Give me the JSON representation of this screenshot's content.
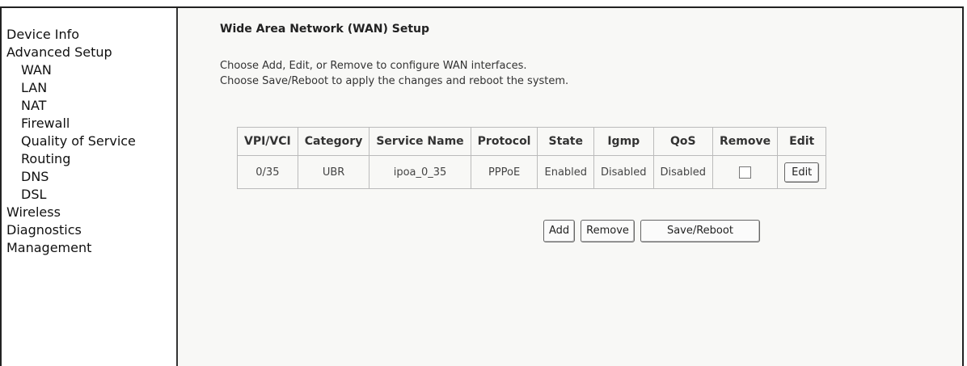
{
  "sidebar": {
    "items": [
      {
        "label": "Device Info",
        "sub": false
      },
      {
        "label": "Advanced Setup",
        "sub": false
      },
      {
        "label": "WAN",
        "sub": true
      },
      {
        "label": "LAN",
        "sub": true
      },
      {
        "label": "NAT",
        "sub": true
      },
      {
        "label": "Firewall",
        "sub": true
      },
      {
        "label": "Quality of Service",
        "sub": true
      },
      {
        "label": "Routing",
        "sub": true
      },
      {
        "label": "DNS",
        "sub": true
      },
      {
        "label": "DSL",
        "sub": true
      },
      {
        "label": "Wireless",
        "sub": false
      },
      {
        "label": "Diagnostics",
        "sub": false
      },
      {
        "label": "Management",
        "sub": false
      }
    ]
  },
  "main": {
    "title": "Wide Area Network (WAN) Setup",
    "desc_line1": "Choose Add, Edit, or Remove to configure WAN interfaces.",
    "desc_line2": "Choose Save/Reboot to apply the changes and reboot the system."
  },
  "table": {
    "headers": [
      "VPI/VCI",
      "Category",
      "Service Name",
      "Protocol",
      "State",
      "Igmp",
      "QoS",
      "Remove",
      "Edit"
    ],
    "rows": [
      {
        "vpi_vci": "0/35",
        "category": "UBR",
        "service_name": "ipoa_0_35",
        "protocol": "PPPoE",
        "state": "Enabled",
        "igmp": "Disabled",
        "qos": "Disabled",
        "remove_checked": false,
        "edit_label": "Edit"
      }
    ]
  },
  "buttons": {
    "add": "Add",
    "remove": "Remove",
    "save_reboot": "Save/Reboot"
  }
}
